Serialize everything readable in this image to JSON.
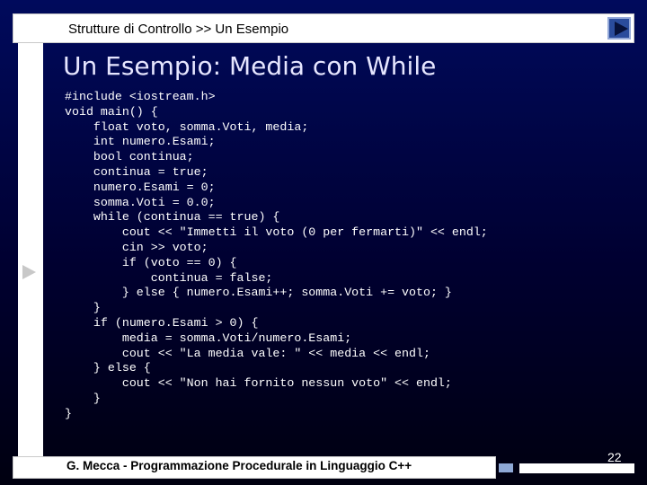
{
  "slide": {
    "breadcrumb": "Strutture di Controllo >> Un Esempio",
    "title": "Un Esempio: Media con While",
    "code_lines": [
      "#include <iostream.h>",
      "void main() {",
      "    float voto, somma.Voti, media;",
      "    int numero.Esami;",
      "    bool continua;",
      "    continua = true;",
      "    numero.Esami = 0;",
      "    somma.Voti = 0.0;",
      "    while (continua == true) {",
      "        cout << \"Immetti il voto (0 per fermarti)\" << endl;",
      "        cin >> voto;",
      "        if (voto == 0) {",
      "            continua = false;",
      "        } else { numero.Esami++; somma.Voti += voto; }",
      "    }",
      "    if (numero.Esami > 0) {",
      "        media = somma.Voti/numero.Esami;",
      "        cout << \"La media vale: \" << media << endl;",
      "    } else {",
      "        cout << \"Non hai fornito nessun voto\" << endl;",
      "    }",
      "}"
    ],
    "footer": "G. Mecca - Programmazione Procedurale in Linguaggio C++",
    "page_number": "22"
  },
  "colors": {
    "background_top": "#000a5c",
    "background_bottom": "#000010",
    "title": "#e6e6ff",
    "code": "#ffffff",
    "nav_button": "#2a4c9c"
  },
  "icons": {
    "next": "play-triangle-icon"
  }
}
